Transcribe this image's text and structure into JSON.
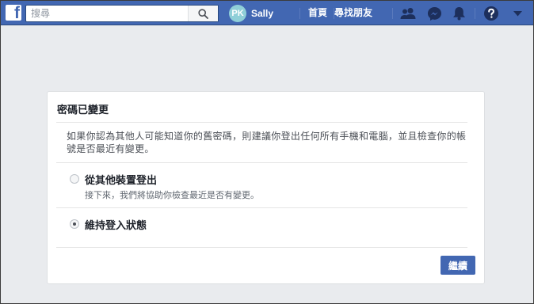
{
  "topbar": {
    "logo_letter": "f",
    "search": {
      "placeholder": "搜尋",
      "value": ""
    },
    "profile": {
      "initials": "PK",
      "name": "Sally"
    },
    "nav": {
      "home": "首頁",
      "find_friends": "尋找朋友"
    },
    "icons": [
      "search-icon",
      "friend-requests-icon",
      "messenger-icon",
      "notifications-icon",
      "help-icon",
      "account-menu-icon"
    ]
  },
  "card": {
    "title": "密碼已變更",
    "description": "如果你認為其他人可能知道你的舊密碼，則建議你登出任何所有手機和電腦，並且檢查你的帳號是否最近有變更。",
    "options": [
      {
        "label": "從其他裝置登出",
        "sublabel": "接下來，我們將協助你檢查最近是否有變更。",
        "selected": false
      },
      {
        "label": "維持登入狀態",
        "sublabel": "",
        "selected": true
      }
    ],
    "continue_label": "繼續"
  },
  "colors": {
    "brand": "#4267b2",
    "page_bg": "#e9ebee",
    "avatar_bg": "#8fcfd8"
  }
}
